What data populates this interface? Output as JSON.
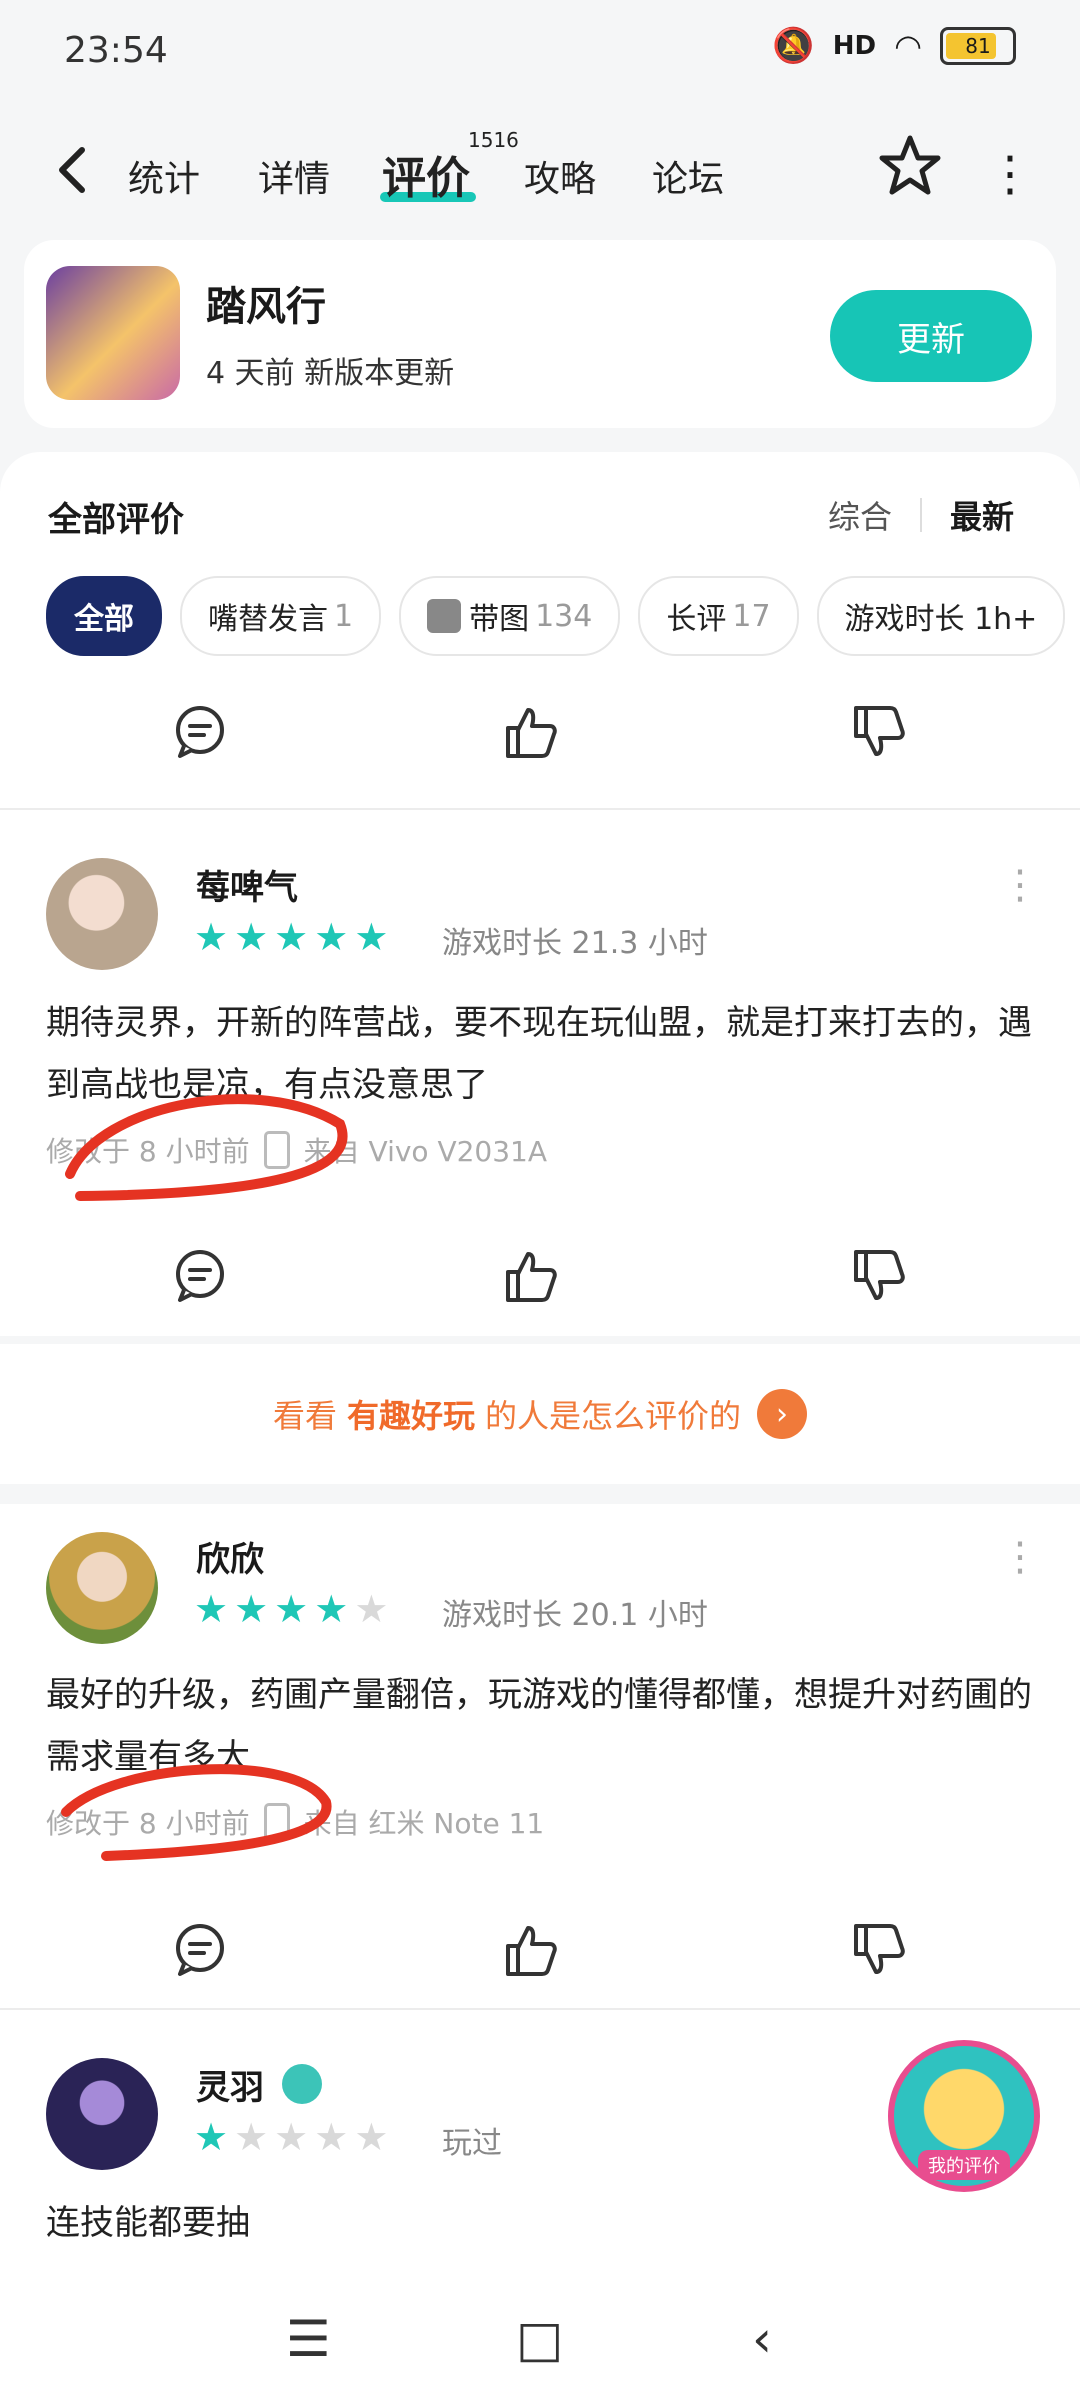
{
  "status_bar": {
    "time": "23:54",
    "battery": "81",
    "signal_label": "HD"
  },
  "nav": {
    "back_icon": "chevron-left-icon",
    "tabs": [
      {
        "label": "统计"
      },
      {
        "label": "详情"
      },
      {
        "label": "评价",
        "badge": "1516"
      },
      {
        "label": "攻略"
      },
      {
        "label": "论坛"
      }
    ],
    "accent_color": "#18c7b7"
  },
  "app": {
    "name": "踏风行",
    "subtitle": "4 天前 新版本更新",
    "update_label": "更新"
  },
  "reviews_header": {
    "title": "全部评价",
    "sort_options": [
      "综合",
      "最新"
    ]
  },
  "filters": [
    {
      "label": "全部",
      "count": ""
    },
    {
      "label": "嘴替发言",
      "count": "1"
    },
    {
      "label": "带图",
      "count": "134"
    },
    {
      "label": "长评",
      "count": "17"
    },
    {
      "label": "游戏时长 1h+",
      "count": ""
    }
  ],
  "reviews": [
    {
      "user": "莓啤气",
      "rating": 5,
      "meta": "游戏时长 21.3 小时",
      "content": "期待灵界，开新的阵营战，要不现在玩仙盟，就是打来打去的，遇到高战也是凉，有点没意思了",
      "modified": "修改于 8 小时前",
      "device": "来自 Vivo V2031A"
    },
    {
      "user": "欣欣",
      "rating": 4,
      "meta": "游戏时长 20.1 小时",
      "content": "最好的升级，药圃产量翻倍，玩游戏的懂得都懂，想提升对药圃的需求量有多大",
      "modified": "修改于 8 小时前",
      "device": "来自 红米 Note 11"
    },
    {
      "user": "灵羽",
      "rating": 1,
      "meta": "玩过",
      "content": "连技能都要抽"
    }
  ],
  "promo": {
    "prefix": "看看",
    "highlight": "有趣好玩",
    "suffix": "的人是怎么评价的"
  },
  "floating": {
    "label": "我的评价"
  }
}
